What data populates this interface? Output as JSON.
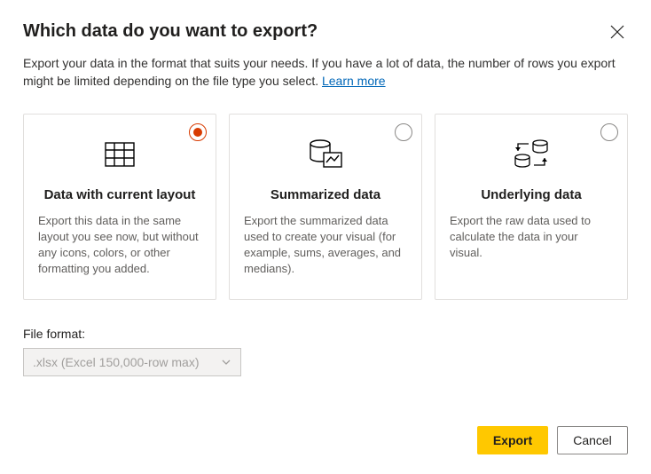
{
  "dialog": {
    "title": "Which data do you want to export?",
    "subtitle": "Export your data in the format that suits your needs. If you have a lot of data, the number of rows you export might be limited depending on the file type you select.  ",
    "learn_more": "Learn more"
  },
  "options": [
    {
      "title": "Data with current layout",
      "desc": "Export this data in the same layout you see now, but without any icons, colors, or other formatting you added.",
      "selected": true
    },
    {
      "title": "Summarized data",
      "desc": "Export the summarized data used to create your visual (for example, sums, averages, and medians).",
      "selected": false
    },
    {
      "title": "Underlying data",
      "desc": "Export the raw data used to calculate the data in your visual.",
      "selected": false
    }
  ],
  "file_format": {
    "label": "File format:",
    "value": ".xlsx (Excel 150,000-row max)"
  },
  "buttons": {
    "export": "Export",
    "cancel": "Cancel"
  }
}
